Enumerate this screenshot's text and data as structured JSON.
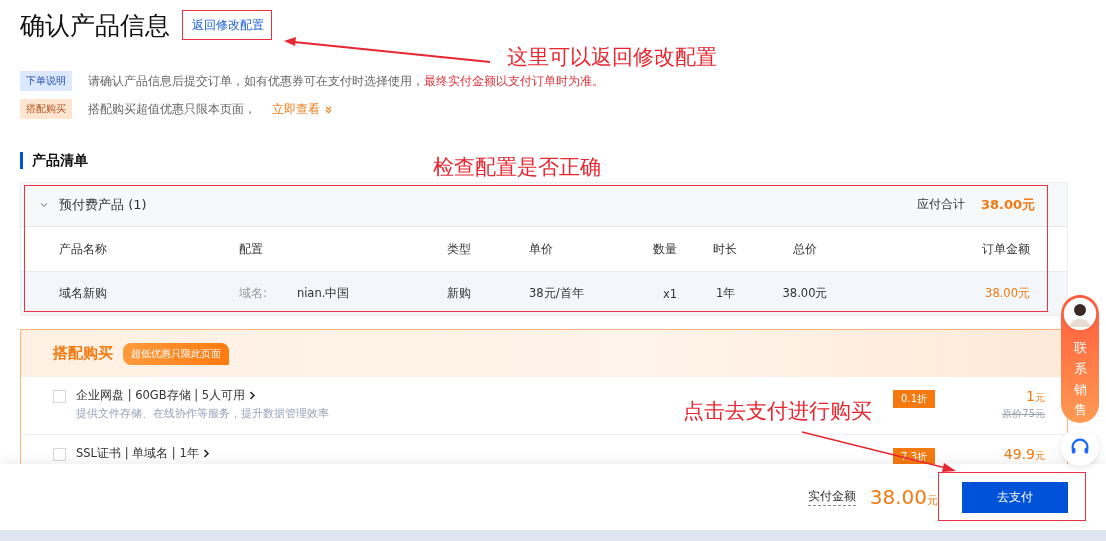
{
  "page": {
    "title": "确认产品信息",
    "back_link": "返回修改配置"
  },
  "notices": [
    {
      "kind": "info",
      "tag": "下单说明",
      "text": "请确认产品信息后提交订单，如有优惠券可在支付时选择使用，",
      "emphasis": "最终实付金额以支付订单时为准。"
    },
    {
      "kind": "promo",
      "tag": "搭配购买",
      "text": "搭配购买超值优惠只限本页面，",
      "link": "立即查看"
    }
  ],
  "product_list": {
    "title": "产品清单",
    "group": {
      "label": "预付费产品 (1)",
      "expanded": true,
      "total_label": "应付合计",
      "total": "38.00元"
    },
    "columns": [
      "产品名称",
      "配置",
      "类型",
      "单价",
      "数量",
      "时长",
      "总价",
      "订单金额"
    ],
    "rows": [
      {
        "name": "域名新购",
        "config_label": "域名:",
        "config_value": "nian.中国",
        "type": "新购",
        "unit_price": "38元/首年",
        "quantity": "x1",
        "duration": "1年",
        "total": "38.00元",
        "amount": "38.00元"
      }
    ]
  },
  "addons": {
    "title": "搭配购买",
    "badge": "超低优惠只限此页面",
    "items": [
      {
        "name": "企业网盘 | 60GB存储 | 5人可用",
        "description": "提供文件存储、在线协作等服务，提升数据管理效率",
        "checked": false,
        "discount": "0.1折",
        "price": "1",
        "unit": "元",
        "original_price": "原价75元"
      },
      {
        "name": "SSL证书 | 单域名 | 1年",
        "checked": false,
        "discount": "7.3折",
        "price": "49.9",
        "unit": "元"
      }
    ]
  },
  "footer": {
    "label": "实付金额",
    "amount": "38.00",
    "unit": "元",
    "pay_button": "去支付"
  },
  "contact": {
    "label": "联系销售"
  },
  "annotations": [
    {
      "text": "这里可以返回修改配置"
    },
    {
      "text": "检查配置是否正确"
    },
    {
      "text": "点击去支付进行购买"
    }
  ]
}
